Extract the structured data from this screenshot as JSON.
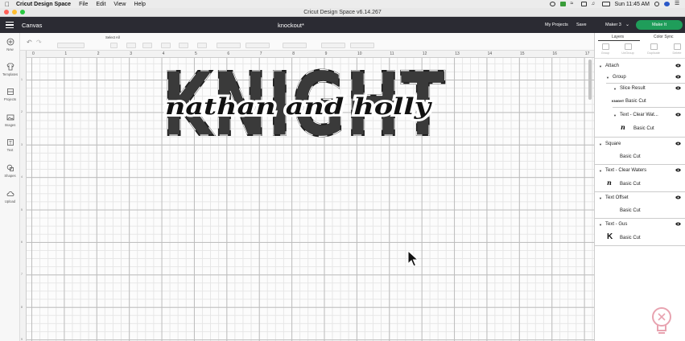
{
  "menubar": {
    "app_name": "Cricut Design Space",
    "items": [
      "File",
      "Edit",
      "View",
      "Help"
    ],
    "clock": "Sun 11:45 AM"
  },
  "window": {
    "title": "Cricut Design Space  v6.14.267"
  },
  "header": {
    "canvas_label": "Canvas",
    "project_name": "knockout*",
    "my_projects": "My Projects",
    "save": "Save",
    "machine": "Maker 3",
    "make_it": "Make It"
  },
  "toolbar": {
    "select_all": "Select All"
  },
  "leftbar": {
    "items": [
      "New",
      "Templates",
      "Projects",
      "Images",
      "Text",
      "Shapes",
      "Upload"
    ]
  },
  "ruler": {
    "top": [
      "0",
      "1",
      "2",
      "3",
      "4",
      "5",
      "6",
      "7",
      "8",
      "9",
      "10",
      "11",
      "12",
      "13",
      "14",
      "15",
      "16",
      "17"
    ],
    "left": [
      "1",
      "2",
      "3",
      "4",
      "5",
      "6",
      "7",
      "8",
      "9"
    ]
  },
  "design": {
    "big_text": "KNIGHT",
    "script_text": "nathan and holly"
  },
  "rightpanel": {
    "tabs": [
      "Layers",
      "Color Sync"
    ],
    "actions": [
      "Group",
      "UnGroup",
      "Duplicate",
      "Delete"
    ],
    "layers": {
      "attach": "Attach",
      "group": "Group",
      "slice_result": "Slice Result",
      "slice_result_sub": "Basic Cut",
      "slice_thumb": "KNIGHT",
      "text_clear_waters_nested": "Text - Clear Wat...",
      "text_clear_waters_nested_sub": "Basic Cut",
      "square": "Square",
      "square_sub": "Basic Cut",
      "text_clear_waters": "Text - Clear Waters",
      "text_clear_waters_sub": "Basic Cut",
      "text_offset": "Text Offset",
      "text_offset_sub": "Basic Cut",
      "text_gus": "Text - Gus",
      "text_gus_sub": "Basic Cut",
      "gus_thumb": "K",
      "script_thumb": "n"
    }
  },
  "colors": {
    "header_bg": "#2b2b33",
    "make_it_green": "#1f9d5a",
    "design_fill": "#3a3a3a"
  }
}
